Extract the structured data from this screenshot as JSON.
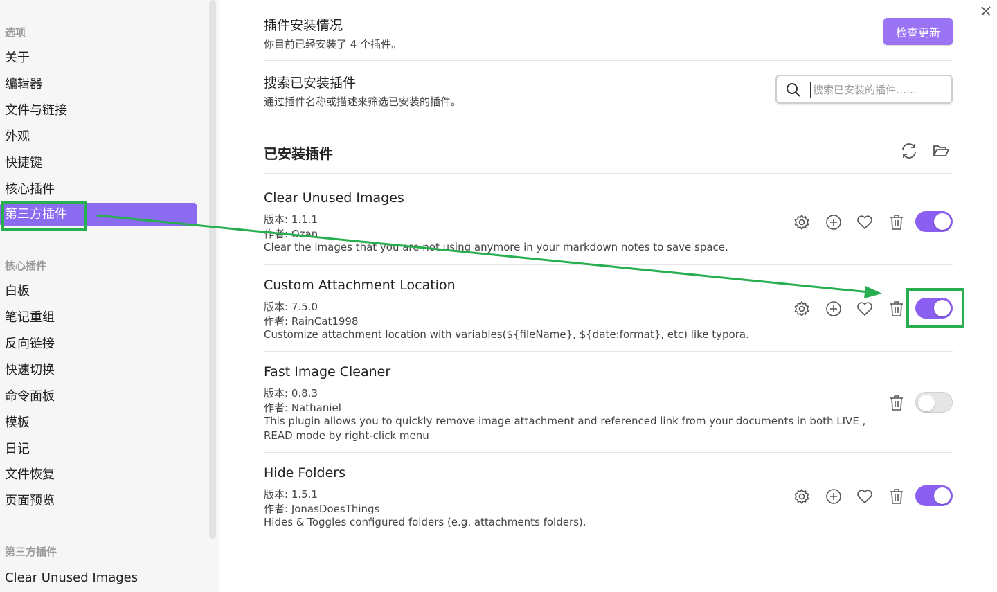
{
  "sidebar": {
    "section_options": "选项",
    "options": [
      "关于",
      "编辑器",
      "文件与链接",
      "外观",
      "快捷键",
      "核心插件",
      "第三方插件"
    ],
    "active_item": "第三方插件",
    "section_core": "核心插件",
    "core": [
      "白板",
      "笔记重组",
      "反向链接",
      "快速切换",
      "命令面板",
      "模板",
      "日记",
      "文件恢复",
      "页面预览"
    ],
    "section_community": "第三方插件",
    "community": [
      "Clear Unused Images"
    ]
  },
  "close_icon": "close-icon",
  "install_status": {
    "title": "插件安装情况",
    "desc": "你目前已经安装了 4 个插件。",
    "check_button": "检查更新"
  },
  "search_installed": {
    "title": "搜索已安装插件",
    "desc": "通过插件名称或描述来筛选已安装的插件。",
    "placeholder": "搜索已安装的插件……"
  },
  "installed_section": {
    "title": "已安装插件",
    "icons": [
      "refresh-icon",
      "folder-open-icon"
    ]
  },
  "plugins": [
    {
      "name": "Clear Unused Images",
      "version": "版本: 1.1.1",
      "author": "作者:  Ozan",
      "desc": "Clear the images that you are not using anymore in your markdown notes to save space.",
      "enabled": true
    },
    {
      "name": "Custom Attachment Location",
      "version": "版本: 7.5.0",
      "author": "作者:  RainCat1998",
      "desc": "Customize attachment location with variables(${fileName}, ${date:format}, etc) like typora.",
      "enabled": true
    },
    {
      "name": "Fast Image Cleaner",
      "version": "版本: 0.8.3",
      "author": "作者:  Nathaniel",
      "desc": "This plugin allows you to quickly remove image attachment and referenced link from your documents in both LIVE ,",
      "desc2": "READ mode by right-click menu",
      "enabled": false
    },
    {
      "name": "Hide Folders",
      "version": "版本: 1.5.1",
      "author": "作者:  JonasDoesThings",
      "desc": "Hides & Toggles configured folders (e.g. attachments folders).",
      "enabled": true
    }
  ],
  "colors": {
    "accent": "#8b5ff2",
    "annotation": "#27ae4f"
  }
}
